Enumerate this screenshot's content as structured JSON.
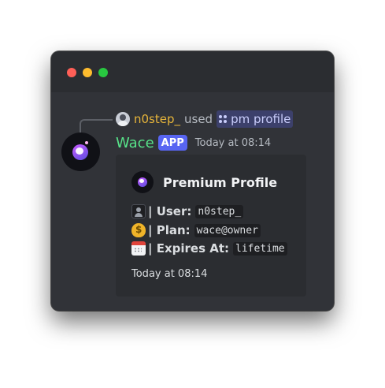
{
  "window": {
    "controls": [
      "close",
      "minimize",
      "maximize"
    ]
  },
  "reply": {
    "avatar_icon": "user-avatar",
    "username": "n0step_",
    "action": "used",
    "command_icon": "slash-command-icon",
    "command": "pm profile"
  },
  "message": {
    "author": "Wace",
    "badge": "APP",
    "timestamp": "Today at 08:14",
    "avatar_icon": "purple-orb-logo"
  },
  "embed": {
    "author_name": "Premium Profile",
    "author_icon": "purple-orb-logo",
    "fields": [
      {
        "icon": "bust-silhouette-emoji",
        "label": "| User:",
        "value": "n0step_"
      },
      {
        "icon": "money-bag-emoji",
        "label": "| Plan:",
        "value": "wace@owner"
      },
      {
        "icon": "calendar-emoji",
        "label": "| Expires At:",
        "value": "lifetime"
      }
    ],
    "footer": "Today at 08:14"
  },
  "colors": {
    "background": "#313338",
    "embed_bg": "#2b2d31",
    "reply_username": "#e7b53a",
    "bot_name": "#57e389",
    "app_badge": "#5865f2",
    "command_chip": "#3c4270"
  }
}
